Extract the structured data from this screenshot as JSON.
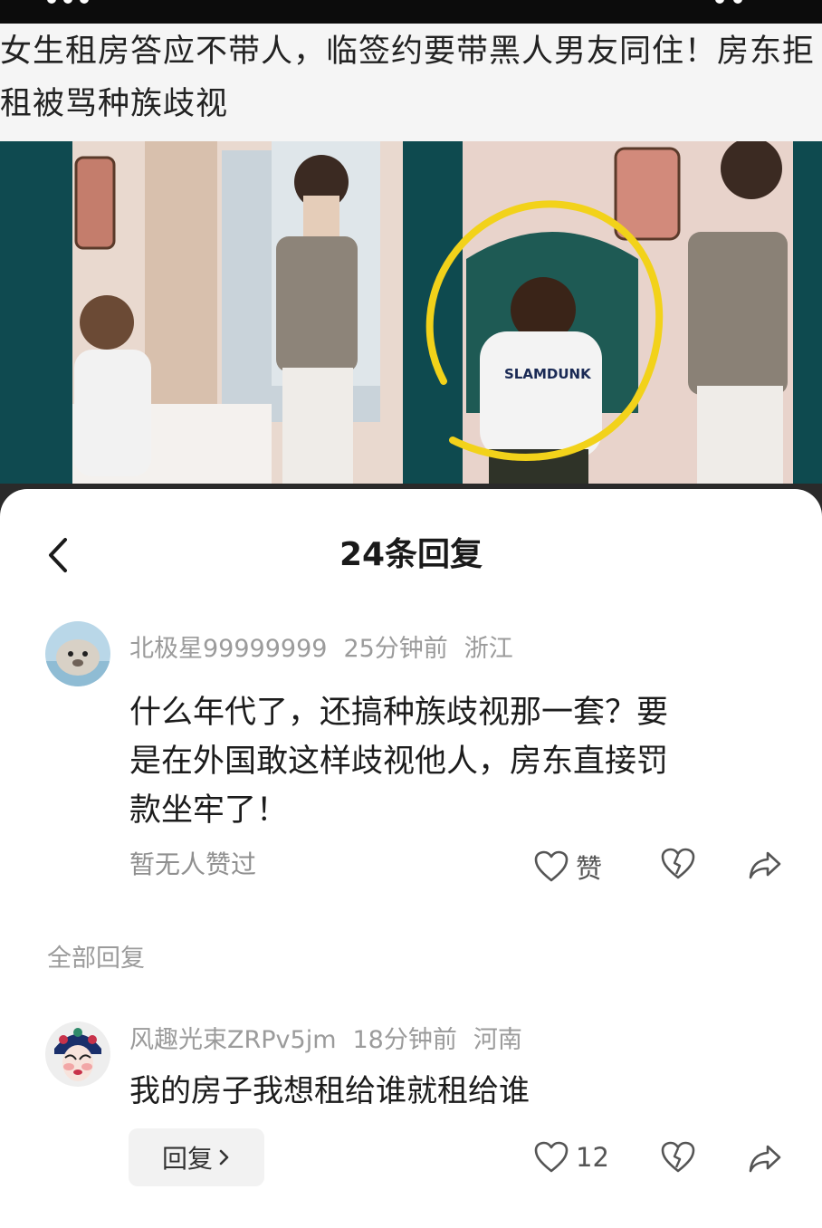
{
  "headline": "女生租房答应不带人，临签约要带黑人男友同住！房东拒租被骂种族歧视",
  "video": {
    "shirt_text": "SLAMDUNK"
  },
  "sheet": {
    "title": "24条回复"
  },
  "main_comment": {
    "username": "北极星99999999",
    "time": "25分钟前",
    "location": "浙江",
    "lines": [
      "什么年代了，还搞种族歧视那一套？要",
      "是在外国敢这样歧视他人，房东直接罚",
      "款坐牢了！"
    ],
    "likes_note": "暂无人赞过",
    "like_label": "赞"
  },
  "section_label": "全部回复",
  "reply": {
    "username": "风趣光束ZRPv5jm",
    "time": "18分钟前",
    "location": "河南",
    "text": "我的房子我想租给谁就租给谁",
    "reply_button_label": "回复",
    "like_count": "12"
  },
  "colors": {
    "sheet_background": "#ffffff",
    "meta_gray": "#9b9b9b",
    "video_teal": "#0d3a3f",
    "highlight_circle": "#f2d21a"
  },
  "icons": [
    "back-arrow-icon",
    "heart-icon",
    "broken-heart-icon",
    "share-icon",
    "chevron-right-icon"
  ]
}
